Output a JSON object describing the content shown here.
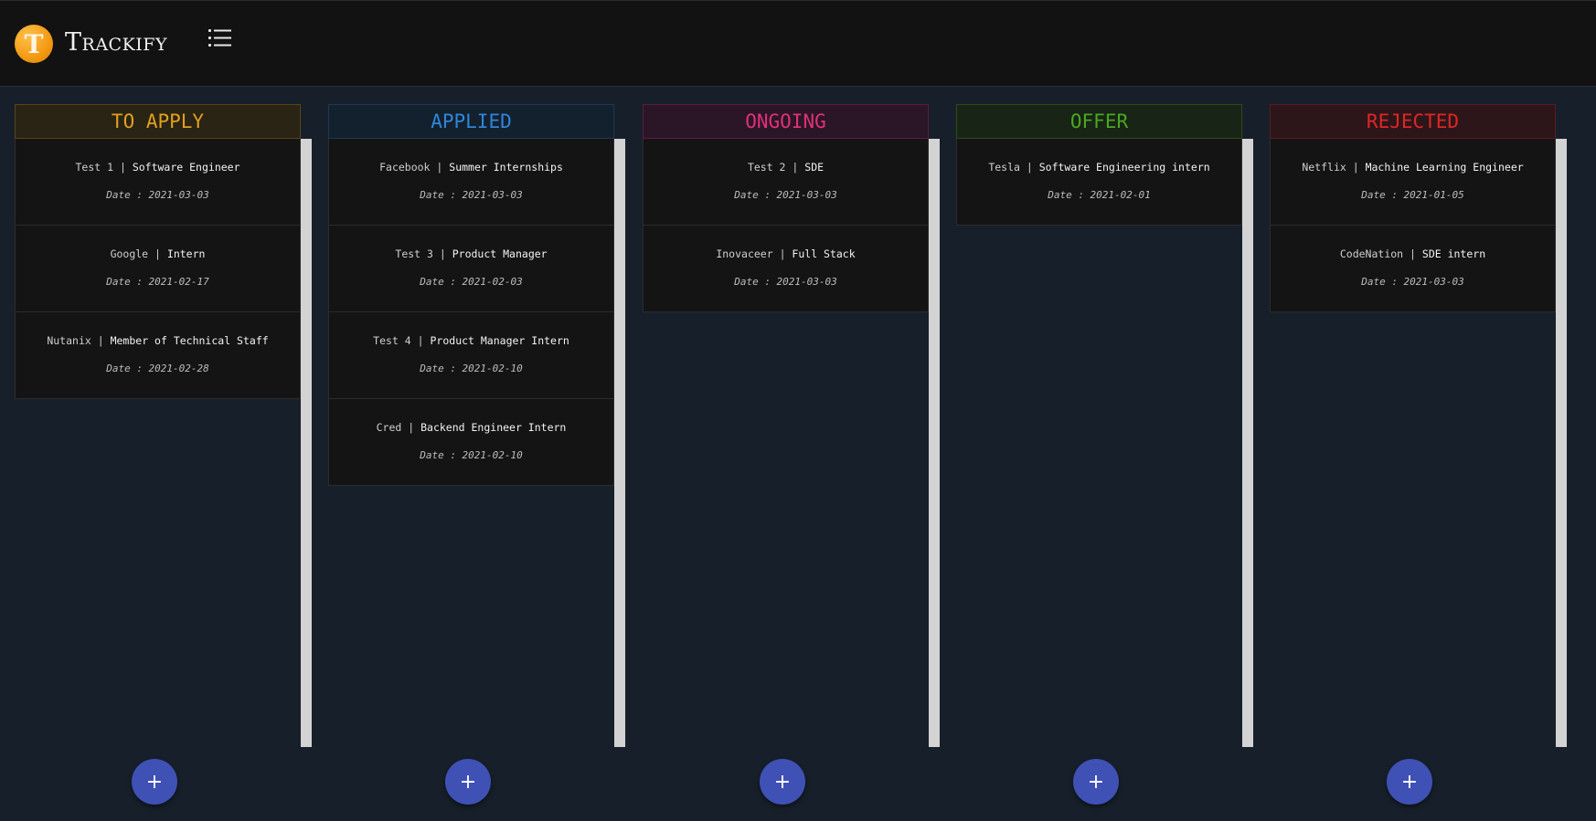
{
  "app": {
    "logo_letter": "T",
    "name": "Trackify",
    "menu_icon": "list-icon"
  },
  "add_label": "+",
  "columns": [
    {
      "title": "TO APPLY",
      "color": "#e0a020",
      "header_bg": "#2a2414",
      "header_border": "#5a4418",
      "cards": [
        {
          "company": "Test 1",
          "role": "Software Engineer",
          "date": "Date : 2021-03-03"
        },
        {
          "company": "Google",
          "role": "Intern",
          "date": "Date : 2021-02-17"
        },
        {
          "company": "Nutanix",
          "role": "Member of Technical Staff",
          "date": "Date : 2021-02-28"
        }
      ]
    },
    {
      "title": "APPLIED",
      "color": "#2f86d8",
      "header_bg": "#13202e",
      "header_border": "#1e3954",
      "cards": [
        {
          "company": "Facebook",
          "role": "Summer Internships",
          "date": "Date : 2021-03-03"
        },
        {
          "company": "Test 3",
          "role": "Product Manager",
          "date": "Date : 2021-02-03"
        },
        {
          "company": "Test 4",
          "role": "Product Manager Intern",
          "date": "Date : 2021-02-10"
        },
        {
          "company": "Cred",
          "role": "Backend Engineer Intern",
          "date": "Date : 2021-02-10"
        }
      ]
    },
    {
      "title": "ONGOING",
      "color": "#e0307a",
      "header_bg": "#2a1626",
      "header_border": "#5a1d3c",
      "cards": [
        {
          "company": "Test 2",
          "role": "SDE",
          "date": "Date : 2021-03-03"
        },
        {
          "company": "Inovaceer",
          "role": "Full Stack",
          "date": "Date : 2021-03-03"
        }
      ]
    },
    {
      "title": "OFFER",
      "color": "#4aa81e",
      "header_bg": "#182416",
      "header_border": "#2b4a1a",
      "cards": [
        {
          "company": "Tesla",
          "role": "Software Engineering intern",
          "date": "Date : 2021-02-01"
        }
      ]
    },
    {
      "title": "REJECTED",
      "color": "#e02626",
      "header_bg": "#2c161a",
      "header_border": "#5a1c20",
      "cards": [
        {
          "company": "Netflix",
          "role": "Machine Learning Engineer",
          "date": "Date : 2021-01-05"
        },
        {
          "company": "CodeNation",
          "role": "SDE intern",
          "date": "Date : 2021-03-03"
        }
      ]
    }
  ]
}
